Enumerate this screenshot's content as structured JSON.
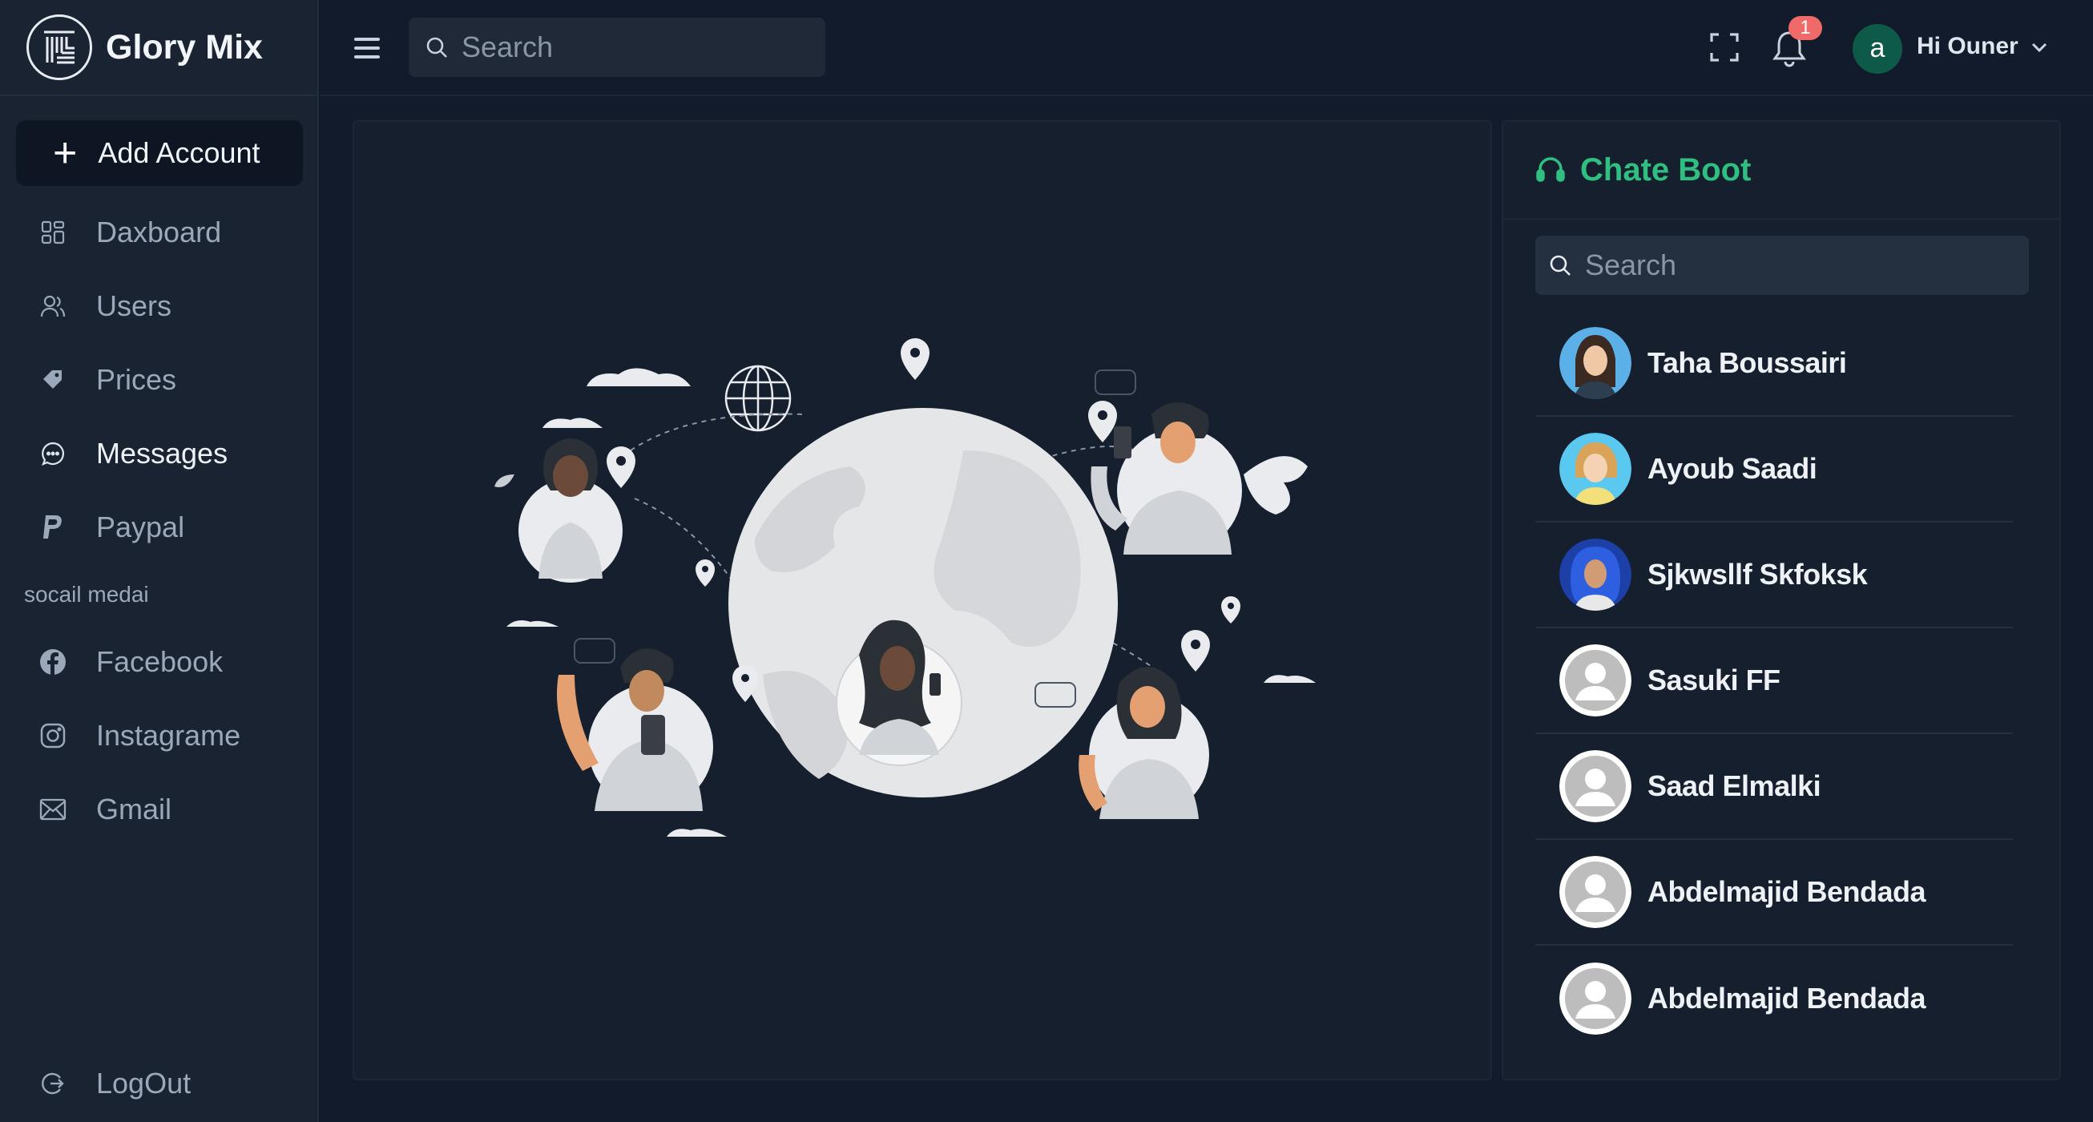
{
  "brand": {
    "name": "Glory Mix"
  },
  "sidebar": {
    "add_account": "Add Account",
    "items": [
      {
        "label": "Daxboard",
        "icon": "dashboard-icon"
      },
      {
        "label": "Users",
        "icon": "users-icon"
      },
      {
        "label": "Prices",
        "icon": "tag-icon"
      },
      {
        "label": "Messages",
        "icon": "message-icon",
        "active": true
      },
      {
        "label": "Paypal",
        "icon": "paypal-icon"
      }
    ],
    "section_label": "socail medai",
    "social": [
      {
        "label": "Facebook",
        "icon": "facebook-icon"
      },
      {
        "label": "Instagrame",
        "icon": "instagram-icon"
      },
      {
        "label": "Gmail",
        "icon": "mail-icon"
      }
    ],
    "logout": "LogOut"
  },
  "header": {
    "search_placeholder": "Search",
    "notification_count": "1",
    "user_initial": "a",
    "greeting": "Hi Ouner"
  },
  "chat": {
    "title": "Chate Boot",
    "search_placeholder": "Search",
    "contacts": [
      {
        "name": "Taha Boussairi",
        "avatar": "woman-brown-hair"
      },
      {
        "name": "Ayoub Saadi",
        "avatar": "woman-blonde"
      },
      {
        "name": "Sjkwsllf Skfoksk",
        "avatar": "woman-blue-hair"
      },
      {
        "name": "Sasuki FF",
        "avatar": "default"
      },
      {
        "name": "Saad Elmalki",
        "avatar": "default"
      },
      {
        "name": "Abdelmajid Bendada",
        "avatar": "default"
      },
      {
        "name": "Abdelmajid Bendada",
        "avatar": "default"
      }
    ]
  },
  "colors": {
    "accent": "#2fc081",
    "background": "#111b2b",
    "sidebar": "#1a2332",
    "badge": "#f06a6a"
  }
}
